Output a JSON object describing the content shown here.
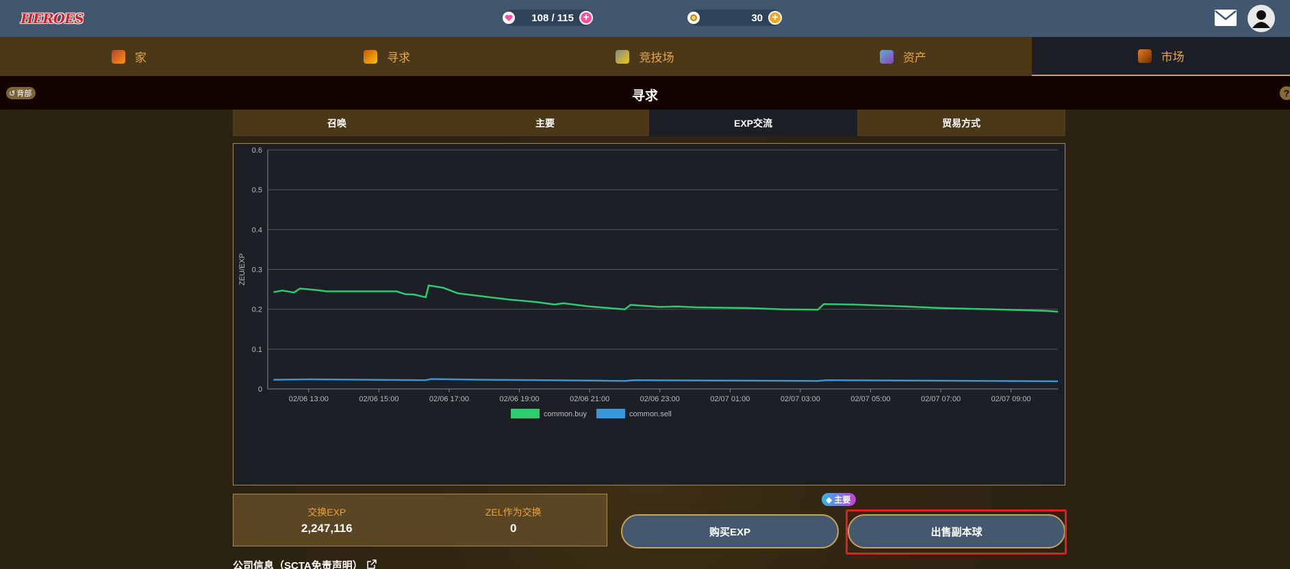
{
  "header": {
    "logo_text": "HEROES",
    "hp": {
      "value": "108 / 115",
      "icon": "heart-icon",
      "color": "#ff4f9d"
    },
    "zel": {
      "value": "30",
      "icon": "coin-icon",
      "color": "#f5a623"
    }
  },
  "nav": {
    "items": [
      {
        "label": "家",
        "icon": "house-icon"
      },
      {
        "label": "寻求",
        "icon": "quest-icon"
      },
      {
        "label": "竞技场",
        "icon": "swords-icon"
      },
      {
        "label": "资产",
        "icon": "assets-icon"
      },
      {
        "label": "市场",
        "icon": "market-icon"
      }
    ],
    "active": "市场"
  },
  "titlebar": {
    "back_label": "背部",
    "title": "寻求"
  },
  "subtabs": {
    "items": [
      "召唤",
      "主要",
      "EXP交流",
      "贸易方式"
    ],
    "active": "EXP交流"
  },
  "chart_data": {
    "type": "line",
    "ylabel": "ZEU/EXP",
    "xlabel": "",
    "ylim": [
      0,
      0.6
    ],
    "yticks": [
      "0",
      "0.1",
      "0.2",
      "0.3",
      "0.4",
      "0.5",
      "0.6"
    ],
    "xticks": [
      "02/06 13:00",
      "02/06 15:00",
      "02/06 17:00",
      "02/06 19:00",
      "02/06 21:00",
      "02/06 23:00",
      "02/07 01:00",
      "02/07 03:00",
      "02/07 05:00",
      "02/07 07:00",
      "02/07 09:00"
    ],
    "grid": true,
    "legend_position": "bottom",
    "series": [
      {
        "name": "common.buy",
        "color": "#2ecc71",
        "points": [
          [
            "02/06 12:00",
            0.243
          ],
          [
            "02/06 12:15",
            0.247
          ],
          [
            "02/06 12:35",
            0.242
          ],
          [
            "02/06 12:45",
            0.252
          ],
          [
            "02/06 13:15",
            0.248
          ],
          [
            "02/06 13:30",
            0.245
          ],
          [
            "02/06 15:30",
            0.245
          ],
          [
            "02/06 15:45",
            0.238
          ],
          [
            "02/06 16:00",
            0.237
          ],
          [
            "02/06 16:20",
            0.23
          ],
          [
            "02/06 16:25",
            0.26
          ],
          [
            "02/06 16:50",
            0.254
          ],
          [
            "02/06 17:15",
            0.24
          ],
          [
            "02/06 18:00",
            0.232
          ],
          [
            "02/06 18:45",
            0.224
          ],
          [
            "02/06 19:30",
            0.218
          ],
          [
            "02/06 20:00",
            0.212
          ],
          [
            "02/06 20:15",
            0.215
          ],
          [
            "02/06 21:00",
            0.207
          ],
          [
            "02/06 22:00",
            0.2
          ],
          [
            "02/06 22:10",
            0.211
          ],
          [
            "02/06 23:00",
            0.206
          ],
          [
            "02/06 23:30",
            0.207
          ],
          [
            "02/07 00:00",
            0.205
          ],
          [
            "02/07 01:30",
            0.203
          ],
          [
            "02/07 02:30",
            0.2
          ],
          [
            "02/07 03:30",
            0.199
          ],
          [
            "02/07 03:40",
            0.213
          ],
          [
            "02/07 04:30",
            0.212
          ],
          [
            "02/07 06:00",
            0.207
          ],
          [
            "02/07 07:00",
            0.203
          ],
          [
            "02/07 08:30",
            0.2
          ],
          [
            "02/07 10:00",
            0.196
          ],
          [
            "02/07 10:20",
            0.194
          ]
        ]
      },
      {
        "name": "common.sell",
        "color": "#3498db",
        "points": [
          [
            "02/06 12:00",
            0.023
          ],
          [
            "02/06 13:00",
            0.024
          ],
          [
            "02/06 16:20",
            0.022
          ],
          [
            "02/06 16:30",
            0.025
          ],
          [
            "02/06 18:00",
            0.023
          ],
          [
            "02/06 21:00",
            0.021
          ],
          [
            "02/06 22:00",
            0.02
          ],
          [
            "02/06 22:15",
            0.022
          ],
          [
            "02/07 03:30",
            0.02
          ],
          [
            "02/07 03:45",
            0.022
          ],
          [
            "02/07 10:20",
            0.019
          ]
        ]
      }
    ]
  },
  "stats": {
    "exchange_exp_label": "交换EXP",
    "exchange_exp_value": "2,247,116",
    "zel_exchange_label": "ZEL作为交换",
    "zel_exchange_value": "0"
  },
  "actions": {
    "buy_label": "购买EXP",
    "sell_label": "出售副本球",
    "badge_label": "主要"
  },
  "footer": {
    "link_label": "公司信息（SCTA免责声明）"
  }
}
